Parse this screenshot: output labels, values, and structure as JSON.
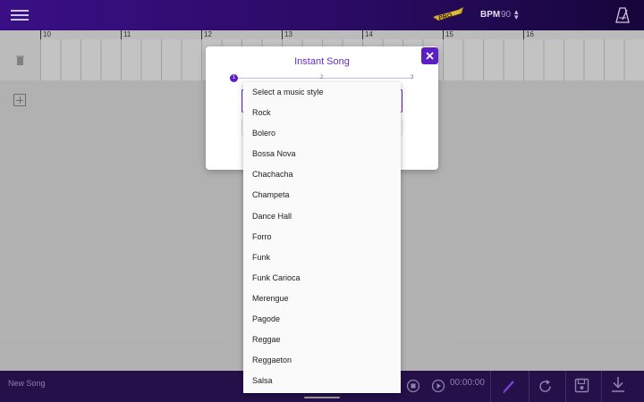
{
  "header": {
    "pro_badge": "PRO",
    "bpm_label": "BPM",
    "bpm_value": "90"
  },
  "timeline": {
    "ruler": [
      "10",
      "11",
      "12",
      "13",
      "14",
      "15",
      "16"
    ]
  },
  "dialog": {
    "title": "Instant Song",
    "steps": [
      "1",
      "2",
      "3"
    ],
    "active_step": 1
  },
  "dropdown": {
    "options": [
      "Select a music style",
      "Rock",
      "Bolero",
      "Bossa Nova",
      "Chachacha",
      "Champeta",
      "Dance Hall",
      "Forro",
      "Funk",
      "Funk Carioca",
      "Merengue",
      "Pagode",
      "Reggae",
      "Reggaeton",
      "Salsa"
    ]
  },
  "footer": {
    "song_name": "New Song",
    "time": "00:00:00"
  },
  "colors": {
    "accent": "#5b1fc4",
    "topbar": "#2a0b63",
    "bottombar": "#25104a"
  }
}
